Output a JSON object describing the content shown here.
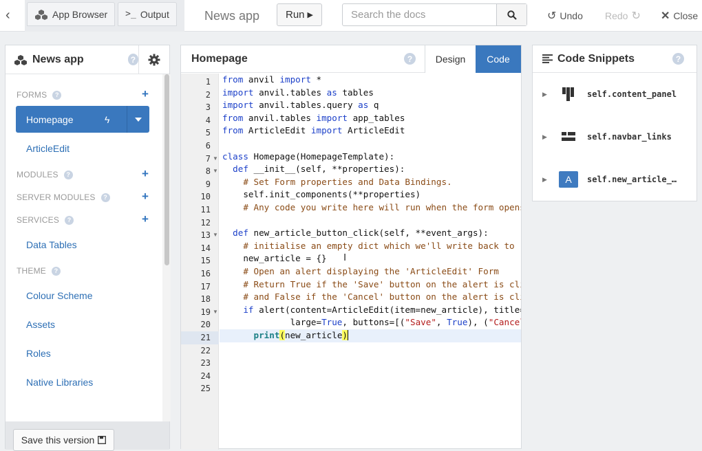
{
  "topbar": {
    "tabs": [
      {
        "label": "App Browser",
        "icon": "cubes-icon"
      },
      {
        "label": "Output",
        "icon": "terminal-icon"
      }
    ],
    "app_title": "News app",
    "run_label": "Run",
    "search_placeholder": "Search the docs",
    "undo_label": "Undo",
    "redo_label": "Redo",
    "close_label": "Close"
  },
  "left_panel": {
    "title": "News app",
    "sections": {
      "forms": "FORMS",
      "modules": "MODULES",
      "server_modules": "SERVER MODULES",
      "services": "SERVICES",
      "theme": "THEME"
    },
    "forms": [
      "Homepage",
      "ArticleEdit"
    ],
    "services": [
      "Data Tables"
    ],
    "theme": [
      "Colour Scheme",
      "Assets",
      "Roles",
      "Native Libraries"
    ],
    "save_label": "Save this version"
  },
  "editor": {
    "title": "Homepage",
    "design_label": "Design",
    "code_label": "Code",
    "line_numbers": [
      "1",
      "2",
      "3",
      "4",
      "5",
      "6",
      "7",
      "8",
      "9",
      "10",
      "11",
      "12",
      "13",
      "14",
      "15",
      "16",
      "17",
      "18",
      "19",
      "20",
      "21",
      "22",
      "23",
      "24",
      "25"
    ],
    "fold_lines": [
      7,
      8,
      13,
      19
    ],
    "active_line": 21
  },
  "snippets": {
    "title": "Code Snippets",
    "items": [
      {
        "label": "self.content_panel",
        "icon": "column-panel-icon"
      },
      {
        "label": "self.navbar_links",
        "icon": "flow-panel-icon"
      },
      {
        "label": "self.new_article_…",
        "icon": "button-icon"
      }
    ]
  }
}
